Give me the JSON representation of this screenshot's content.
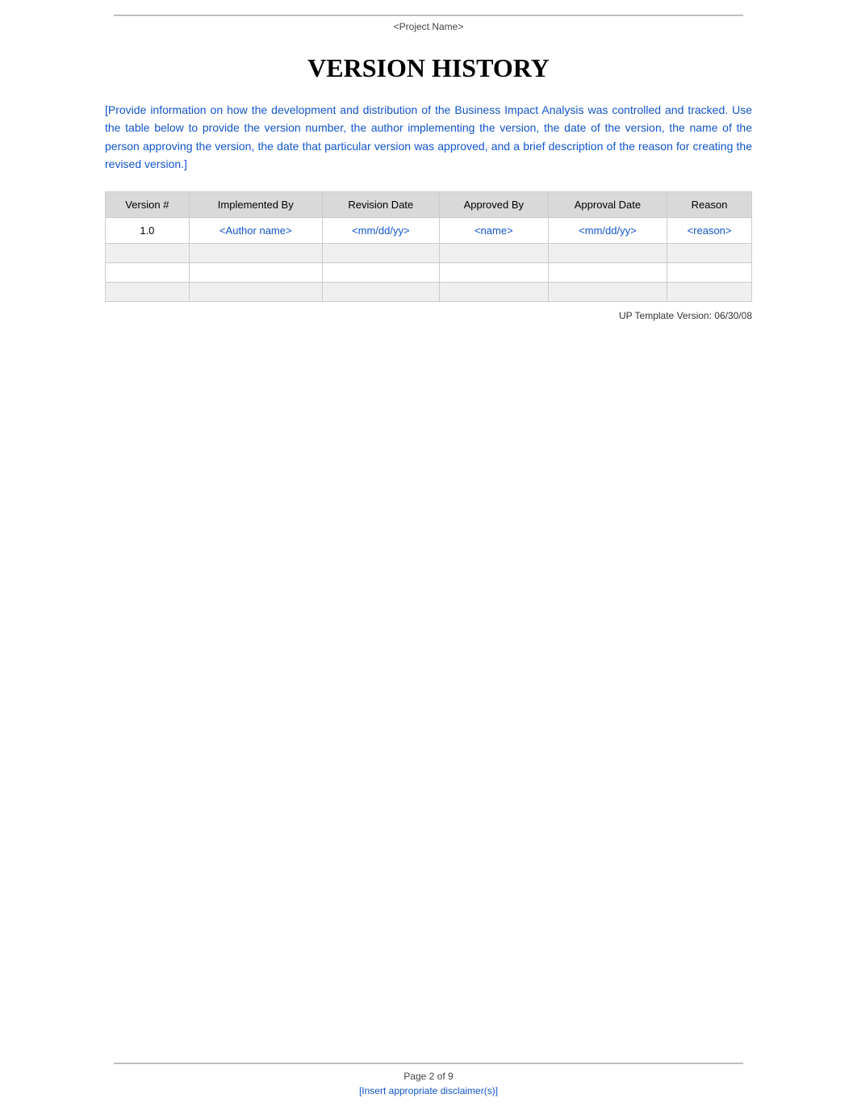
{
  "header": {
    "line_decoration": "line",
    "project_name": "<Project Name>"
  },
  "page": {
    "title": "VERSION HISTORY",
    "intro_text": "[Provide information on how the development and distribution of the Business Impact Analysis was controlled and tracked.      Use the table below to provide the version number, the author implementing the version, the date of the version, the name of the person approving the version, the date that particular version was approved, and a brief description of the reason for creating the revised version.]"
  },
  "table": {
    "headers": [
      "Version #",
      "Implemented By",
      "Revision Date",
      "Approved By",
      "Approval Date",
      "Reason"
    ],
    "rows": [
      {
        "version": "1.0",
        "implemented_by": "<Author name>",
        "revision_date": "<mm/dd/yy>",
        "approved_by": "<name>",
        "approval_date": "<mm/dd/yy>",
        "reason": "<reason>"
      },
      {
        "version": "",
        "implemented_by": "",
        "revision_date": "",
        "approved_by": "",
        "approval_date": "",
        "reason": ""
      },
      {
        "version": "",
        "implemented_by": "",
        "revision_date": "",
        "approved_by": "",
        "approval_date": "",
        "reason": ""
      },
      {
        "version": "",
        "implemented_by": "",
        "revision_date": "",
        "approved_by": "",
        "approval_date": "",
        "reason": ""
      }
    ]
  },
  "template_version": {
    "label": "UP Template Version:",
    "value": "06/30/08"
  },
  "footer": {
    "page_info": "Page  2 of 9",
    "disclaimer": "[Insert appropriate disclaimer(s)]"
  }
}
